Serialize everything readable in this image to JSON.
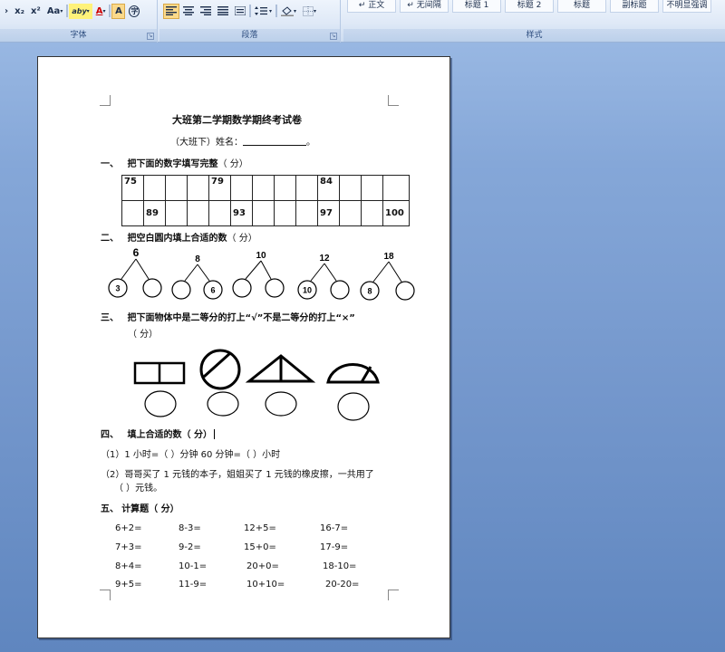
{
  "ribbon": {
    "font_tools": [
      "x₂",
      "x²",
      "Aa",
      "aby",
      "A",
      "A",
      "字"
    ],
    "font_group_label": "字体",
    "paragraph_group_label": "段落",
    "styles_group_label": "样式",
    "styles": [
      "↵ 正文",
      "↵ 无间隔",
      "标题 1",
      "标题 2",
      "标题",
      "副标题",
      "不明显强调"
    ]
  },
  "doc": {
    "title": "大班第二学期数学期终考试卷",
    "subtitle": "（大班下）姓名：",
    "subtitle_end": "。",
    "q1": {
      "num": "一、",
      "text": "把下面的数字填写完整",
      "score": "（    分）"
    },
    "table": {
      "row1": [
        "75",
        "",
        "",
        "",
        "79",
        "",
        "",
        "",
        "",
        "84",
        "",
        "",
        ""
      ],
      "row2": [
        "",
        "89",
        "",
        "",
        "",
        "93",
        "",
        "",
        "",
        "97",
        "",
        "",
        "100"
      ]
    },
    "q2": {
      "num": "二、",
      "text": "把空白圆内填上合适的数",
      "score": "（    分）"
    },
    "trees": [
      {
        "top": "6",
        "left": "3",
        "right": ""
      },
      {
        "top": "8",
        "left": "",
        "right": "6"
      },
      {
        "top": "10",
        "left": "",
        "right": ""
      },
      {
        "top": "12",
        "left": "10",
        "right": ""
      },
      {
        "top": "18",
        "left": "8",
        "right": ""
      }
    ],
    "q3": {
      "num": "三、",
      "text": "把下面物体中是二等分的打上“√”不是二等分的打上“×”",
      "score": "（    分）"
    },
    "q4": {
      "num": "四、",
      "text": "填上合适的数（    分）",
      "line1": "（1）1 小时=（           ）分钟      60 分钟=（           ）小时",
      "line2": "（2）哥哥买了 1 元钱的本子，姐姐买了 1 元钱的橡皮擦，一共用了",
      "line3": "（           ）元钱。"
    },
    "q5": {
      "num": "五、",
      "text": "计算题（    分）"
    },
    "calcs": [
      [
        "6+2=",
        "8-3=",
        "12+5=",
        "16-7="
      ],
      [
        "7+3=",
        "9-2=",
        "15+0=",
        "17-9="
      ],
      [
        "8+4=",
        "10-1=",
        "20+0=",
        "18-10="
      ],
      [
        "9+5=",
        "11-9=",
        "10+10=",
        "20-20="
      ]
    ]
  }
}
